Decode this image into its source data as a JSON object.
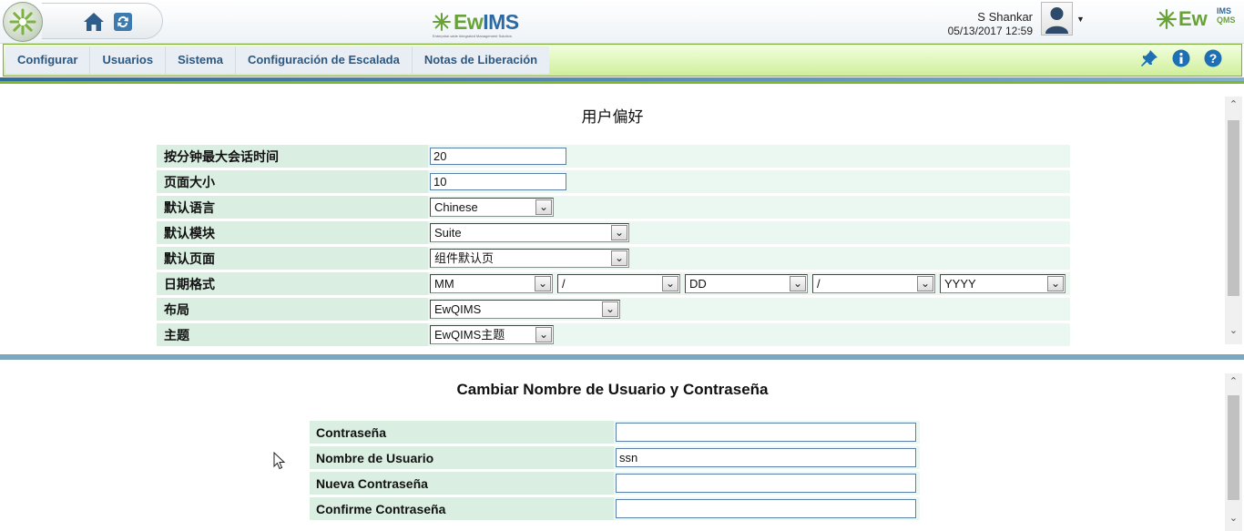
{
  "header": {
    "center_logo": "EwIMS",
    "center_logo_tagline": "Enterprise-wide Integrated Management Solution",
    "right_logo": "Ew",
    "right_logo_sup": "IMS",
    "right_logo_sub": "QMS",
    "user_name": "S Shankar",
    "datetime": "05/13/2017 12:59",
    "icons": [
      "home-icon",
      "refresh-icon",
      "user-avatar-icon",
      "chevron-down-icon"
    ]
  },
  "menu": {
    "items": [
      "Configurar",
      "Usuarios",
      "Sistema",
      "Configuración de Escalada",
      "Notas de Liberación"
    ],
    "icons": [
      "pin-icon",
      "info-icon",
      "help-icon"
    ]
  },
  "preferences": {
    "title": "用户偏好",
    "rows": [
      {
        "label": "按分钟最大会话时间",
        "value": "20"
      },
      {
        "label": "页面大小",
        "value": "10"
      },
      {
        "label": "默认语言",
        "value": "Chinese"
      },
      {
        "label": "默认模块",
        "value": "Suite"
      },
      {
        "label": "默认页面",
        "value": "组件默认页"
      },
      {
        "label": "日期格式",
        "values": [
          "MM",
          "/",
          "DD",
          "/",
          "YYYY"
        ]
      },
      {
        "label": "布局",
        "value": "EwQIMS"
      },
      {
        "label": "主题",
        "value": "EwQIMS主题"
      }
    ]
  },
  "account": {
    "title": "Cambiar Nombre de Usuario y Contraseña",
    "rows": [
      {
        "label": "Contraseña",
        "value": ""
      },
      {
        "label": "Nombre de Usuario",
        "value": "ssn"
      },
      {
        "label": "Nueva Contraseña",
        "value": ""
      },
      {
        "label": "Confirme Contraseña",
        "value": ""
      }
    ]
  },
  "colors": {
    "menu_text": "#2b5882",
    "label_bg": "#daeee2",
    "value_bg": "#ebf8f1",
    "menu_green": "#cfef9a",
    "divider": "#7ba7bf"
  }
}
